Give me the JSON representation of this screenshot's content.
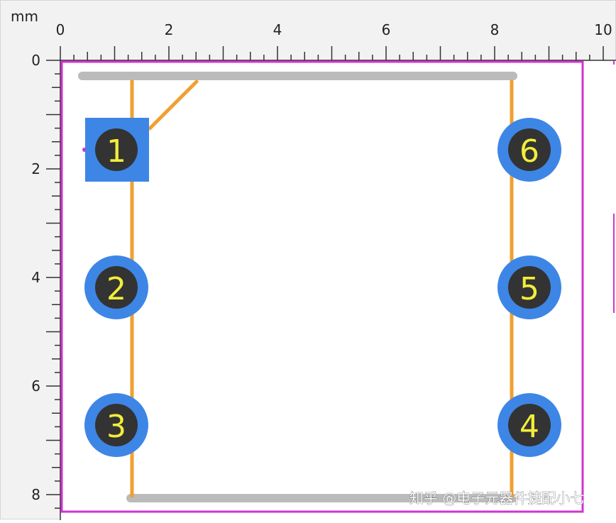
{
  "ruler": {
    "unit": "mm",
    "x_labels": [
      "0",
      "2",
      "4",
      "6",
      "8",
      "10"
    ],
    "y_labels": [
      "0",
      "2",
      "4",
      "6",
      "8"
    ]
  },
  "pads": [
    {
      "number": "1",
      "shape": "square"
    },
    {
      "number": "2",
      "shape": "round"
    },
    {
      "number": "3",
      "shape": "round"
    },
    {
      "number": "4",
      "shape": "round"
    },
    {
      "number": "5",
      "shape": "round"
    },
    {
      "number": "6",
      "shape": "round"
    }
  ],
  "colors": {
    "pad": "#3d86e6",
    "drill": "#333333",
    "pad_label": "#f2ee3a",
    "silkscreen": "#f0a030",
    "courtyard": "#d233d2",
    "keepout_bar": "#bbbbbb",
    "ruler_background": "#f2f2f2",
    "canvas": "#ffffff"
  },
  "watermark": {
    "text": "知乎 @电子元器件捷配小七"
  }
}
